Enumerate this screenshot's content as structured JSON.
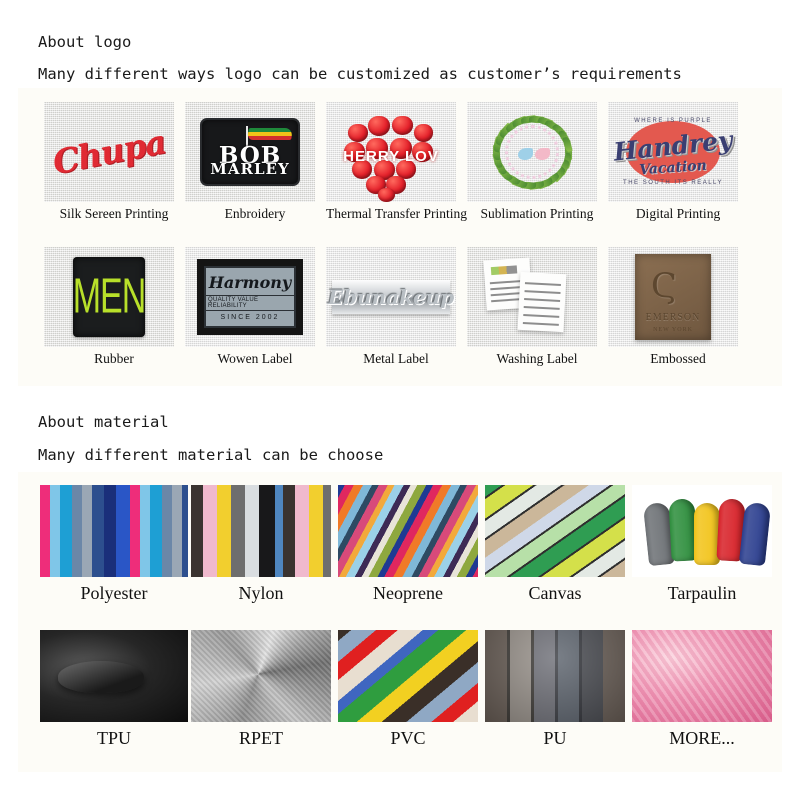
{
  "sections": [
    {
      "title": "About logo",
      "subtitle": "Many different ways logo can be customized as customer’s requirements",
      "rows": [
        [
          {
            "label": "Silk Sereen Printing",
            "art": "chupa",
            "text": "Chupa"
          },
          {
            "label": "Enbroidery",
            "art": "bobmarley",
            "text_top": "BOB",
            "text_bottom": "MARLEY"
          },
          {
            "label": "Thermal Transfer Printing",
            "art": "heart",
            "text": "HERRY LOV"
          },
          {
            "label": "Sublimation Printing",
            "art": "wreath",
            "text": ""
          },
          {
            "label": "Digital Printing",
            "art": "handrey",
            "text": "Handrey",
            "text_sub": "Vacation",
            "text_top": "WHERE IS PURPLE",
            "text_bottom": "THE SOUTH ITS REALLY"
          }
        ],
        [
          {
            "label": "Rubber",
            "art": "men",
            "text": "MEN"
          },
          {
            "label": "Wowen Label",
            "art": "harmony",
            "text": "Harmony",
            "text_sub": "QUALITY VALUE RELIABILITY",
            "text_third": "SINCE 2002"
          },
          {
            "label": "Metal Label",
            "art": "metal",
            "text": "Ebunakeup"
          },
          {
            "label": "Washing Label",
            "art": "washing",
            "text": ""
          },
          {
            "label": "Embossed",
            "art": "embossed",
            "text": "EMERSON",
            "text_sub": "NEW YORK"
          }
        ]
      ]
    },
    {
      "title": "About material",
      "subtitle": "Many different material can be choose",
      "rows": [
        [
          {
            "label": "Polyester",
            "art": "poly"
          },
          {
            "label": "Nylon",
            "art": "nylon"
          },
          {
            "label": "Neoprene",
            "art": "neo"
          },
          {
            "label": "Canvas",
            "art": "canvas"
          },
          {
            "label": "Tarpaulin",
            "art": "tarp"
          }
        ],
        [
          {
            "label": "TPU",
            "art": "tpu"
          },
          {
            "label": "RPET",
            "art": "rpet"
          },
          {
            "label": "PVC",
            "art": "pvc"
          },
          {
            "label": "PU",
            "art": "pu"
          },
          {
            "label": "MORE...",
            "art": "more"
          }
        ]
      ]
    }
  ],
  "colors": {
    "panel_background": "#fdfcf7",
    "page_background": "#ffffff",
    "text": "#1a1a1a",
    "chupa_red": "#e02a33",
    "men_green": "#b8e02a",
    "leather_brown": "#8b6f52"
  },
  "tarpaulin_rolls": [
    "#6e7276",
    "#2f8f3e",
    "#f2c41b",
    "#d8232a",
    "#2c3f8f"
  ]
}
